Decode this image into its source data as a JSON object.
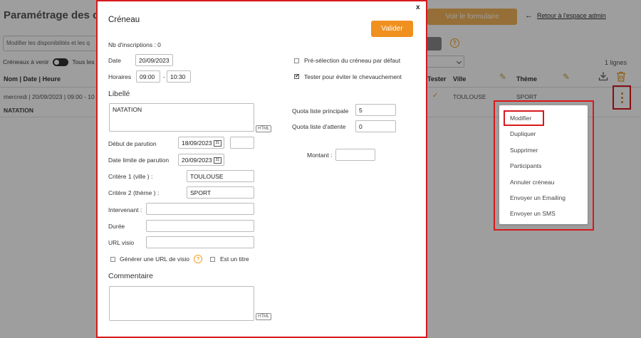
{
  "background": {
    "page_title": "Paramétrage des c",
    "header_button": "Voir le formulaire",
    "back_link": "Retour à l'espace admin",
    "search_value": "Modifier les disponibilités et les q",
    "toggle_upcoming": "Créneaux à venir",
    "toggle_all": "Tous les c",
    "line_count": "1 lignes",
    "columns": {
      "name_date_hour": "Nom | Date | Heure",
      "tester": "Tester",
      "city": "Ville",
      "theme": "Thème"
    },
    "row": {
      "date_time": "mercredi | 20/09/2023 | 09:00 - 10",
      "city": "TOULOUSE",
      "theme": "SPORT",
      "name": "NATATION"
    },
    "accent_color": "#f0b35a"
  },
  "context_menu": {
    "items": [
      {
        "label": "Modifier"
      },
      {
        "label": "Dupliquer"
      },
      {
        "label": "Supprimer"
      },
      {
        "label": "Participants"
      },
      {
        "label": "Annuler créneau"
      },
      {
        "label": "Envoyer un Emailing"
      },
      {
        "label": "Envoyer un SMS"
      }
    ]
  },
  "modal": {
    "title": "Créneau",
    "close_label": "x",
    "submit_label": "Valider",
    "nb_inscriptions": "Nb d'inscriptions : 0",
    "date_label": "Date",
    "date_value": "20/09/2023",
    "hours_label": "Horaires",
    "start_time": "09:00",
    "time_separator": "-",
    "end_time": "10:30",
    "preselection_label": "Pré-sélection du créneau par défaut",
    "preselection_checked": false,
    "overlap_label": "Tester pour éviter le chevauchement",
    "overlap_checked": true,
    "libelle_heading": "Libellé",
    "libelle_value": "NATATION",
    "html_badge": "HTML",
    "quota_main_label": "Quota liste principale",
    "quota_main_value": "5",
    "quota_wait_label": "Quota liste d'attente",
    "quota_wait_value": "0",
    "publish_start_label": "Début de parution",
    "publish_start_value": "18/09/2023",
    "publish_end_label": "Date limite de parution",
    "publish_end_value": "20/09/2023",
    "calendar_icon_text": "31",
    "amount_label": "Montant :",
    "amount_value": "",
    "criteria1_label": "Critère 1 (ville ) :",
    "criteria1_value": "TOULOUSE",
    "criteria2_label": "Critère 2 (thème ) :",
    "criteria2_value": "SPORT",
    "speaker_label": "Intervenant :",
    "duration_label": "Durée",
    "visio_label": "URL visio",
    "generate_visio_label": "Générer une URL de visio",
    "is_title_label": "Est un titre",
    "comment_heading": "Commentaire",
    "help_glyph": "?",
    "primary_color": "#f0901e",
    "highlight_color": "#d8191c"
  }
}
